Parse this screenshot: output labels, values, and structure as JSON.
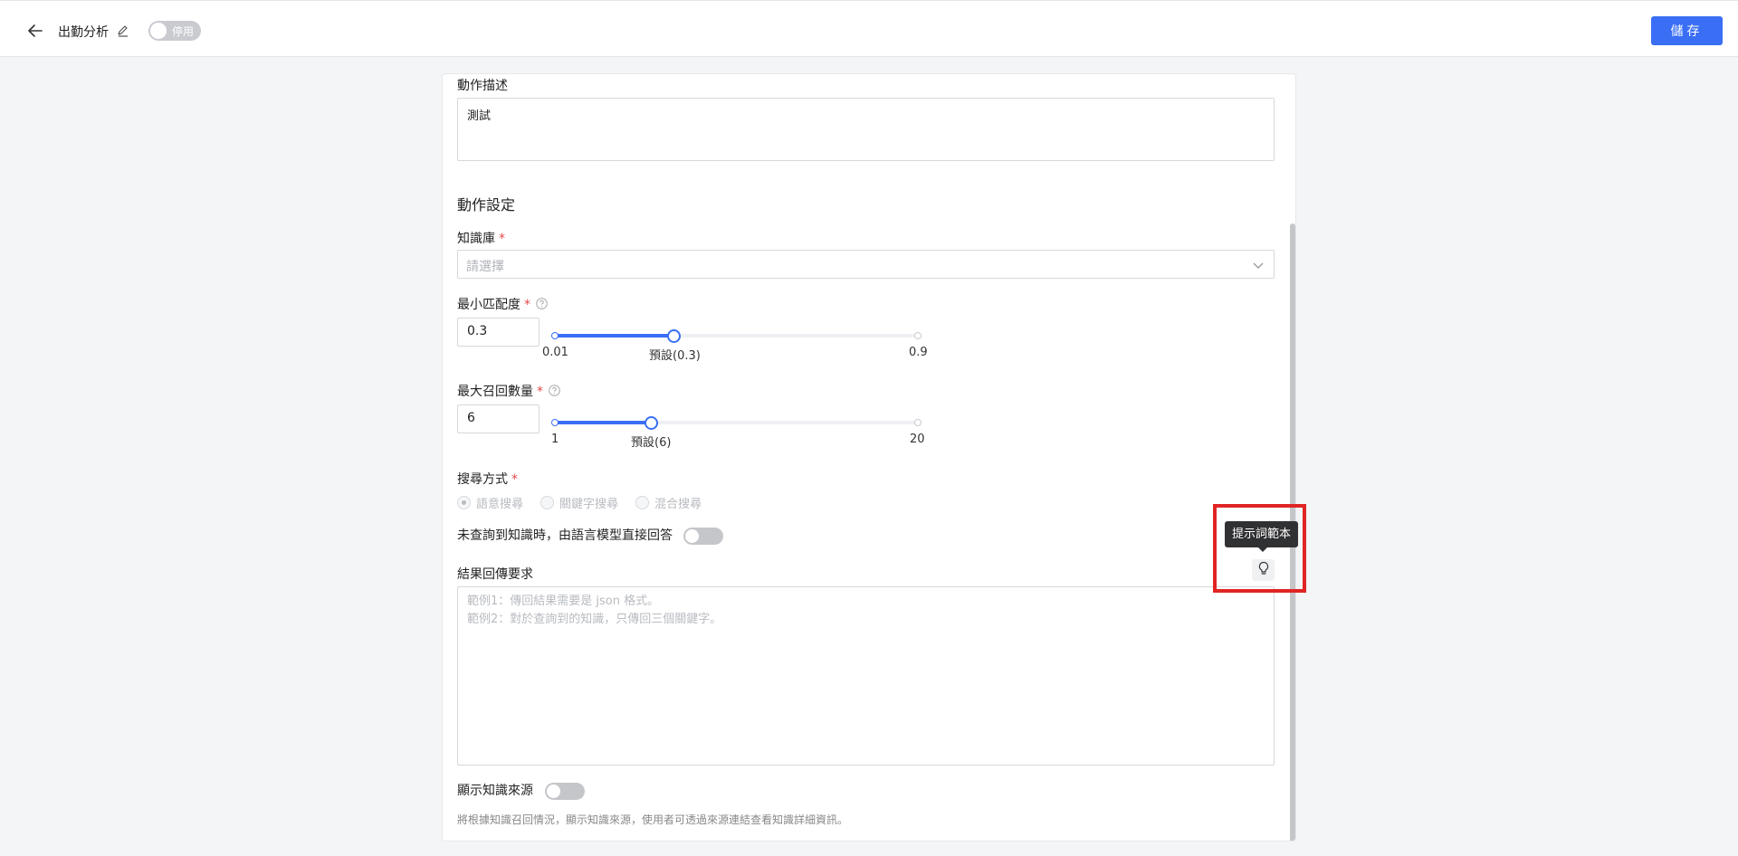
{
  "header": {
    "title": "出勤分析",
    "status_toggle_label": "停用",
    "save_label": "儲存"
  },
  "form": {
    "description_label": "動作描述",
    "description_value": "測試",
    "section_title": "動作設定",
    "knowledge_base": {
      "label": "知識庫",
      "placeholder": "請選擇"
    },
    "min_match": {
      "label": "最小匹配度",
      "value": "0.3",
      "min_label": "0.01",
      "default_label": "預設(0.3)",
      "max_label": "0.9",
      "min": 0.01,
      "max": 0.9,
      "current": 0.3
    },
    "max_recall": {
      "label": "最大召回數量",
      "value": "6",
      "min_label": "1",
      "default_label": "預設(6)",
      "max_label": "20",
      "min": 1,
      "max": 20,
      "current": 6
    },
    "search_mode": {
      "label": "搜尋方式",
      "options": [
        "語意搜尋",
        "關鍵字搜尋",
        "混合搜尋"
      ],
      "selected": "語意搜尋"
    },
    "direct_answer_label": "未查詢到知識時，由語言模型直接回答",
    "result_requirement": {
      "label": "結果回傳要求",
      "placeholder_line1": "範例1：傳回結果需要是 json 格式。",
      "placeholder_line2": "範例2：對於查詢到的知識，只傳回三個關鍵字。"
    },
    "show_source": {
      "label": "顯示知識來源",
      "hint": "將根據知識召回情況，顯示知識來源，使用者可透過來源連結查看知識詳細資訊。"
    }
  },
  "tooltip": {
    "text": "提示詞範本"
  },
  "colors": {
    "accent": "#3a6ef5",
    "required": "#e5484d",
    "highlight": "#e02424"
  }
}
